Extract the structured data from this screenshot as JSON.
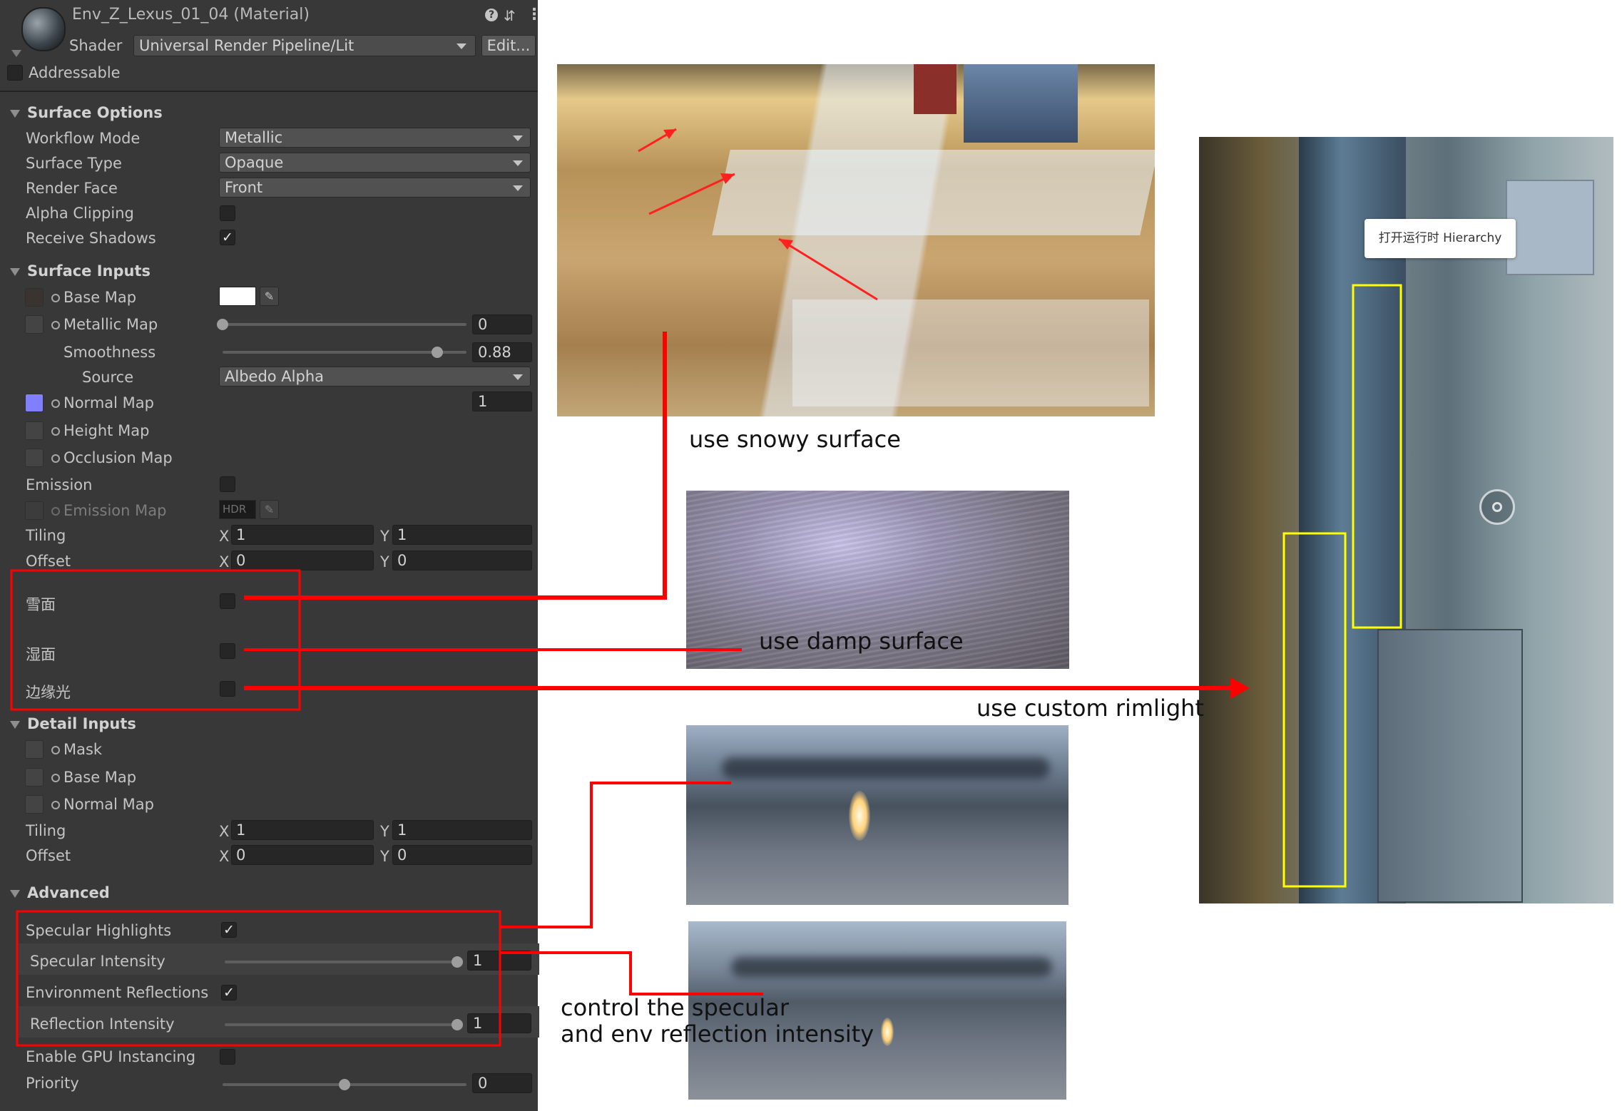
{
  "header": {
    "title": "Env_Z_Lexus_01_04 (Material)",
    "shader_label": "Shader",
    "shader_value": "Universal Render Pipeline/Lit",
    "edit_label": "Edit...",
    "addressable_label": "Addressable"
  },
  "surface_options": {
    "title": "Surface Options",
    "workflow_mode_label": "Workflow Mode",
    "workflow_mode_value": "Metallic",
    "surface_type_label": "Surface Type",
    "surface_type_value": "Opaque",
    "render_face_label": "Render Face",
    "render_face_value": "Front",
    "alpha_clipping_label": "Alpha Clipping",
    "receive_shadows_label": "Receive Shadows"
  },
  "surface_inputs": {
    "title": "Surface Inputs",
    "base_map_label": "Base Map",
    "metallic_map_label": "Metallic Map",
    "metallic_value": "0",
    "smoothness_label": "Smoothness",
    "smoothness_value": "0.88",
    "source_label": "Source",
    "source_value": "Albedo Alpha",
    "normal_map_label": "Normal Map",
    "normal_value": "1",
    "height_map_label": "Height Map",
    "occlusion_map_label": "Occlusion Map",
    "emission_label": "Emission",
    "emission_map_label": "Emission Map",
    "hdr_label": "HDR",
    "tiling_label": "Tiling",
    "tiling_x": "1",
    "tiling_y": "1",
    "offset_label": "Offset",
    "offset_x": "0",
    "offset_y": "0",
    "x_label": "X",
    "y_label": "Y"
  },
  "custom": {
    "snow_label": "雪面",
    "wet_label": "湿面",
    "rim_label": "边缘光"
  },
  "detail_inputs": {
    "title": "Detail Inputs",
    "mask_label": "Mask",
    "base_map_label": "Base Map",
    "normal_map_label": "Normal Map",
    "tiling_label": "Tiling",
    "tiling_x": "1",
    "tiling_y": "1",
    "offset_label": "Offset",
    "offset_x": "0",
    "offset_y": "0"
  },
  "advanced": {
    "title": "Advanced",
    "specular_highlights_label": "Specular Highlights",
    "specular_intensity_label": "Specular Intensity",
    "specular_intensity_value": "1",
    "env_reflections_label": "Environment Reflections",
    "reflection_intensity_label": "Reflection Intensity",
    "reflection_intensity_value": "1",
    "gpu_instancing_label": "Enable GPU Instancing",
    "priority_label": "Priority",
    "priority_value": "0"
  },
  "slider_levels": {
    "metallic": 0.0,
    "smoothness": 0.88,
    "specular_intensity": 1.0,
    "reflection_intensity": 1.0,
    "priority": 0.5
  },
  "annotations": {
    "snowy": "use snowy surface",
    "damp": "use damp surface",
    "rimlight": "use custom rimlight",
    "specular_line1": "control the specular",
    "specular_line2": "and env reflection intensity",
    "hierarchy_button": "打开运行时 Hierarchy"
  },
  "colors": {
    "inspector_bg": "#383838",
    "annotation_red": "#ff0000",
    "highlight_yellow": "#ffff00"
  }
}
